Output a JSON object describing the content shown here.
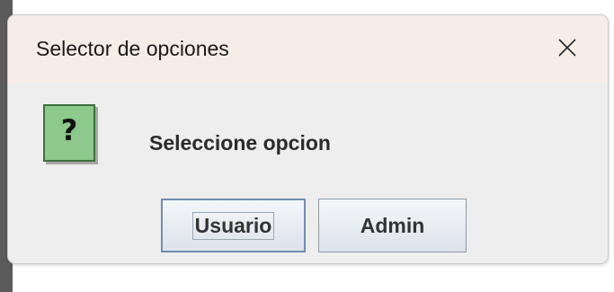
{
  "dialog": {
    "title": "Selector de opciones",
    "message": "Seleccione opcion",
    "icon": "question-icon",
    "icon_glyph": "?",
    "buttons": {
      "usuario": "Usuario",
      "admin": "Admin"
    },
    "default_button": "Usuario"
  },
  "colors": {
    "titlebar": "#f7ede7",
    "body": "#eeeeee",
    "icon_fill": "#8cc98a",
    "button_focus_border": "#6e8fb0"
  }
}
